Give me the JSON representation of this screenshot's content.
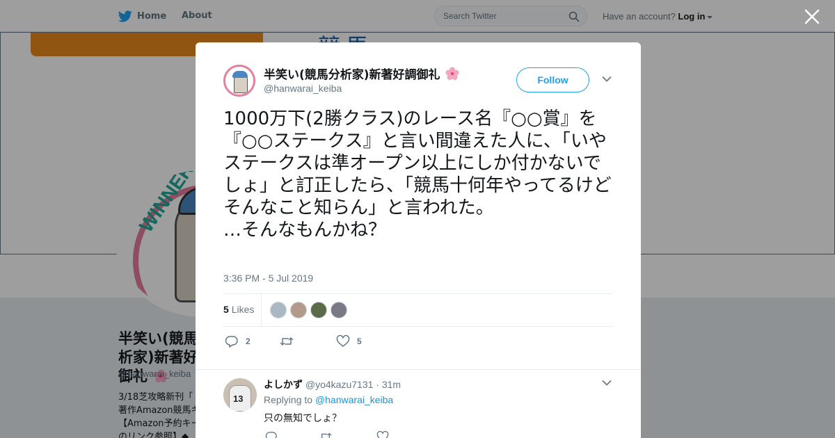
{
  "topbar": {
    "home_label": "Home",
    "about_label": "About",
    "search_placeholder": "Search Twitter",
    "account_prompt": "Have an account?",
    "login_label": "Log in"
  },
  "profile": {
    "name": "半笑い(競馬分析家)新著好調御礼",
    "handle": "@hanwarai_keiba",
    "bio_lines": [
      "3/18芝攻略新刊「",
      "著作Amazon競馬キ",
      "【Amazon予約キー",
      "のリンク参照】◆"
    ]
  },
  "tweet": {
    "author_name": "半笑い(競馬分析家)新著好調御礼",
    "author_handle": "@hanwarai_keiba",
    "follow_label": "Follow",
    "text": "1000万下(2勝クラス)のレース名『○○賞』を『○○ステークス』と言い間違えた人に、「いやステークスは準オープン以上にしか付かないでしょ」と訂正したら、「競馬十何年やってるけどそんなこと知らん」と言われた。\n…そんなもんかね？",
    "timestamp": "3:36 PM - 5 Jul 2019",
    "likes_count": "5",
    "likes_label": "Likes",
    "reply_count": "2",
    "retweet_count": "",
    "like_count": "5"
  },
  "reply": {
    "name": "よしかず",
    "handle": "@yo4kazu7131",
    "time": "· 31m",
    "replying_prefix": "Replying to",
    "replying_to": "@hanwarai_keiba",
    "text": "只の無知でしょ？",
    "avatar_number": "13"
  },
  "colors": {
    "accent": "#1da1f2",
    "text_primary": "#14171a",
    "text_secondary": "#657786",
    "overlay": "rgba(0,0,0,0.38)"
  },
  "icons": [
    "twitter-bird-icon",
    "search-icon",
    "close-icon",
    "chevron-down-icon",
    "reply-icon",
    "retweet-icon",
    "heart-icon",
    "cherry-blossom-icon"
  ]
}
